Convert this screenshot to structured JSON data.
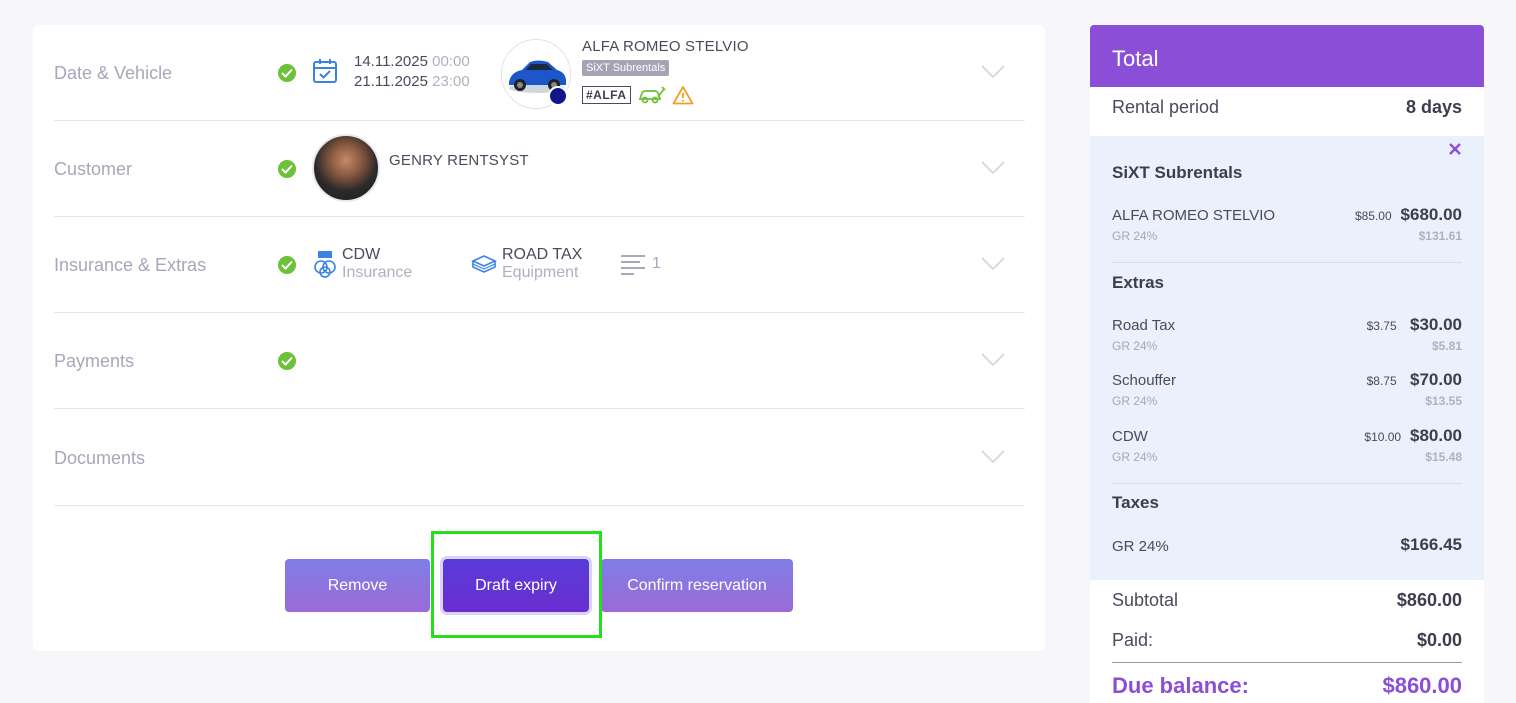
{
  "sections": {
    "date_vehicle": {
      "title": "Date & Vehicle",
      "pickup_date": "14.11.2025",
      "pickup_time": "00:00",
      "return_date": "21.11.2025",
      "return_time": "23:00",
      "vehicle_name": "ALFA ROMEO STELVIO",
      "supplier": "SiXT Subrentals",
      "plate": "#ALFA"
    },
    "customer": {
      "title": "Customer",
      "name": "GENRY RENTSYST"
    },
    "insurance_extras": {
      "title": "Insurance & Extras",
      "insurance_name": "CDW",
      "insurance_type": "Insurance",
      "equipment_name": "ROAD TAX",
      "equipment_type": "Equipment",
      "other_count": "1"
    },
    "payments": {
      "title": "Payments"
    },
    "documents": {
      "title": "Documents"
    }
  },
  "actions": {
    "remove": "Remove",
    "draft_expiry": "Draft expiry",
    "confirm": "Confirm reservation"
  },
  "total": {
    "header": "Total",
    "rental_period_label": "Rental period",
    "rental_period_value": "8 days",
    "supplier_group": {
      "title": "SiXT Subrentals",
      "items": [
        {
          "name": "ALFA ROMEO STELVIO",
          "tax_label": "GR 24%",
          "unit": "$85.00",
          "amount": "$680.00",
          "tax": "$131.61"
        }
      ]
    },
    "extras_group": {
      "title": "Extras",
      "items": [
        {
          "name": "Road Tax",
          "tax_label": "GR 24%",
          "unit": "$3.75",
          "amount": "$30.00",
          "tax": "$5.81"
        },
        {
          "name": "Schouffer",
          "tax_label": "GR 24%",
          "unit": "$8.75",
          "amount": "$70.00",
          "tax": "$13.55"
        },
        {
          "name": "CDW",
          "tax_label": "GR 24%",
          "unit": "$10.00",
          "amount": "$80.00",
          "tax": "$15.48"
        }
      ]
    },
    "taxes_group": {
      "title": "Taxes",
      "label": "GR 24%",
      "value": "$166.45"
    },
    "subtotal_label": "Subtotal",
    "subtotal_value": "$860.00",
    "paid_label": "Paid:",
    "paid_value": "$0.00",
    "due_label": "Due balance:",
    "due_value": "$860.00"
  },
  "colors": {
    "accent": "#8a4fd6",
    "check": "#6cc136",
    "highlight": "#22e01a"
  }
}
